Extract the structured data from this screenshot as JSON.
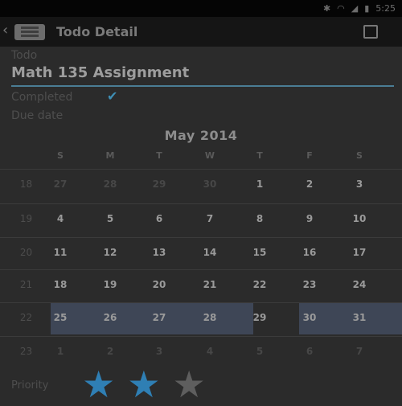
{
  "status": {
    "time": "5:25"
  },
  "actionbar": {
    "title": "Todo Detail"
  },
  "form": {
    "task_label": "Todo",
    "task_value": "Math 135 Assignment",
    "completed_label": "Completed",
    "due_label": "Due date"
  },
  "calendar": {
    "month": "May 2014",
    "weekdays": [
      "S",
      "M",
      "T",
      "W",
      "T",
      "F",
      "S"
    ],
    "weeks": [
      {
        "week": "18",
        "days": [
          "27",
          "28",
          "29",
          "30",
          "1",
          "2",
          "3"
        ]
      },
      {
        "week": "19",
        "days": [
          "4",
          "5",
          "6",
          "7",
          "8",
          "9",
          "10"
        ]
      },
      {
        "week": "20",
        "days": [
          "11",
          "12",
          "13",
          "14",
          "15",
          "16",
          "17"
        ]
      },
      {
        "week": "21",
        "days": [
          "18",
          "19",
          "20",
          "21",
          "22",
          "23",
          "24"
        ]
      },
      {
        "week": "22",
        "days": [
          "25",
          "26",
          "27",
          "28",
          "29",
          "30",
          "31"
        ]
      },
      {
        "week": "23",
        "days": [
          "1",
          "2",
          "3",
          "4",
          "5",
          "6",
          "7"
        ]
      }
    ],
    "highlight_dates": [
      "25",
      "26",
      "27",
      "28",
      "30",
      "31"
    ]
  },
  "priority": {
    "label": "Priority",
    "rating": 2,
    "max": 3,
    "active_color": "#2f7fb4",
    "inactive_color": "#5e5e5e"
  }
}
